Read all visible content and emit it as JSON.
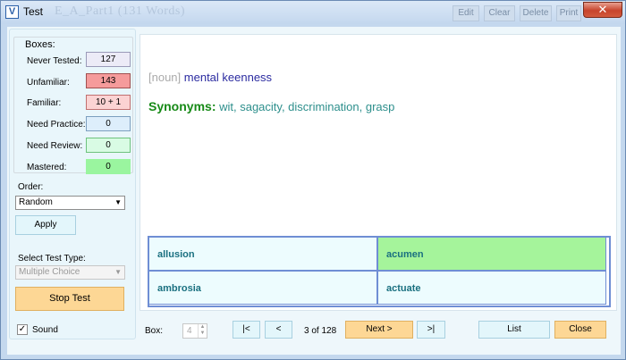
{
  "window": {
    "title": "Test",
    "ghost_title": "E_A_Part1 (131 Words)",
    "ghost_buttons": [
      "Edit",
      "Clear",
      "Delete",
      "Print"
    ]
  },
  "boxes": {
    "label": "Boxes:",
    "rows": [
      {
        "label": "Never Tested:",
        "value": "127",
        "bg": "#ecebf7",
        "border": "#9a9ab8"
      },
      {
        "label": "Unfamiliar:",
        "value": "143",
        "bg": "#f59b9b",
        "border": "#a05050"
      },
      {
        "label": "Familiar:",
        "value": "10 + 1",
        "bg": "#fbd3d3",
        "border": "#c07070"
      },
      {
        "label": "Need Practice:",
        "value": "0",
        "bg": "#ddeefb",
        "border": "#7c9fbf"
      },
      {
        "label": "Need Review:",
        "value": "0",
        "bg": "#d9fbe4",
        "border": "#6ec27e"
      },
      {
        "label": "Mastered:",
        "value": "0",
        "bg": "#9af59f",
        "border": "#9af59f"
      }
    ]
  },
  "order": {
    "label": "Order:",
    "value": "Random",
    "apply_label": "Apply"
  },
  "test_type": {
    "label": "Select Test Type:",
    "value": "Multiple Choice"
  },
  "stop_label": "Stop Test",
  "sound": {
    "label": "Sound",
    "checked": true
  },
  "card": {
    "part_of_speech": "[noun]",
    "definition": "mental keenness",
    "synonyms_key": "Synonyms",
    "synonyms": "wit, sagacity, discrimination, grasp"
  },
  "choices": [
    {
      "word": "allusion",
      "highlight": false
    },
    {
      "word": "acumen",
      "highlight": true
    },
    {
      "word": "ambrosia",
      "highlight": false
    },
    {
      "word": "actuate",
      "highlight": false
    }
  ],
  "nav": {
    "box_label": "Box:",
    "box_value": "4",
    "first_label": "|<",
    "prev_label": "<",
    "position": "3 of 128",
    "next_label": "Next >",
    "last_label": ">|",
    "list_label": "List",
    "close_label": "Close"
  },
  "colors": {
    "highlight_choice": "#a5f49b",
    "choice_bg": "#edfcfe",
    "orange_button": "#fdd795"
  }
}
